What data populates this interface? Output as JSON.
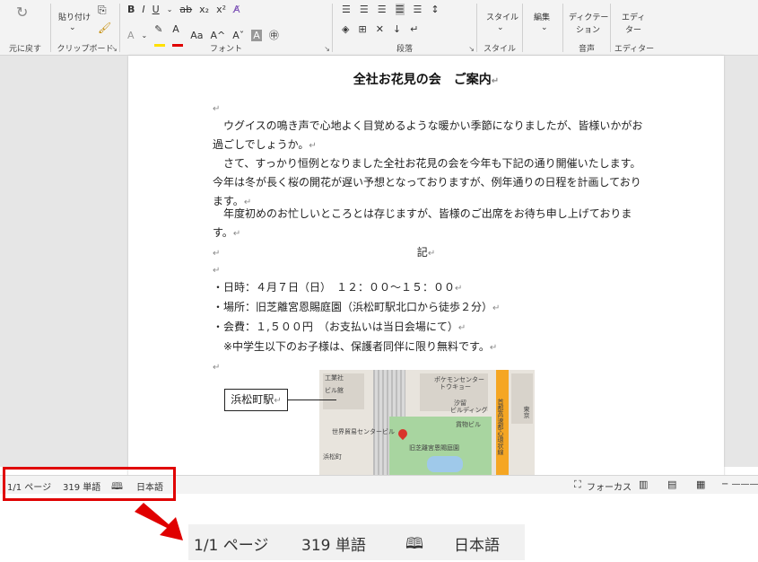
{
  "ribbon": {
    "undo_group_label": "元に戻す",
    "clipboard": {
      "paste_label": "貼り付け",
      "group_label": "クリップボード"
    },
    "font": {
      "group_label": "フォント",
      "bold": "B",
      "italic": "I",
      "underline": "U",
      "strike": "ab",
      "subscript": "x₂",
      "superscript": "x²",
      "size_toggle": "Aa",
      "grow": "A^",
      "shrink": "Aˇ",
      "char_shading": "A"
    },
    "paragraph": {
      "group_label": "段落"
    },
    "styles": {
      "button_label": "スタイル",
      "group_label": "スタイル"
    },
    "editing": {
      "button_label": "編集"
    },
    "voice": {
      "dictate_label": "ディクテーション",
      "dictate_label_line1": "ディクテー",
      "dictate_label_line2": "ション",
      "group_label": "音声"
    },
    "editor": {
      "button_label": "エディター",
      "button_label_line1": "エディ",
      "button_label_line2": "ター",
      "group_label": "エディター"
    }
  },
  "document": {
    "title": "全社お花見の会　ご案内",
    "para1_line1": "　ウグイスの鳴き声で心地よく目覚めるような暖かい季節になりましたが、皆様いかがお",
    "para1_line2": "過ごしでしょうか。",
    "para2_line1": "　さて、すっかり恒例となりました全社お花見の会を今年も下記の通り開催いたします。",
    "para2_line2": "今年は冬が長く桜の開花が遅い予想となっておりますが、例年通りの日程を計画しており",
    "para2_line3": "ます。",
    "para3_line1": "　年度初めのお忙しいところとは存じますが、皆様のご出席をお待ち申し上げております。",
    "ki": "記",
    "item_date": "・日時：４月７日（日）　１２：００～１５：００",
    "item_place": "・場所：旧芝離宮恩賜庭園（浜松町駅北口から徒歩２分）",
    "item_fee": "・会費：１,５００円　（お支払いは当日会場にて）",
    "item_note": "　※中学生以下のお子様は、保護者同伴に限り無料です。",
    "para_mark": "↵",
    "callout": "浜松町駅",
    "map_labels": {
      "factory": "工業社",
      "building": "ビル館",
      "pokemon1": "ポケモンセンター",
      "pokemon2": "トウキョー",
      "shiodome1": "汐留",
      "shiodome2": "ビルディング",
      "cargo": "貨物ビル",
      "wtc": "世界貿易センタービル",
      "garden": "旧芝離宮恩賜庭園",
      "hamamatsucho": "浜松町",
      "expressway": "首都高速都心環状線",
      "east": "東京"
    }
  },
  "statusbar": {
    "page": "1/1 ページ",
    "words": "319 単語",
    "language": "日本語",
    "focus": "フォーカス"
  },
  "zoomed": {
    "page": "1/1 ページ",
    "words": "319 単語",
    "language": "日本語"
  },
  "colors": {
    "highlight_box": "#e00000",
    "arrow": "#e00000",
    "font_color_bar": "#e00000",
    "highlight_bar": "#ffe000",
    "park": "#a8d5a0",
    "expressway": "#f5a623"
  },
  "icons": {
    "undo": "undo-icon",
    "read_mode": "book-icon",
    "focus": "focus-icon",
    "print_layout": "page-icon",
    "web_layout": "web-icon"
  }
}
